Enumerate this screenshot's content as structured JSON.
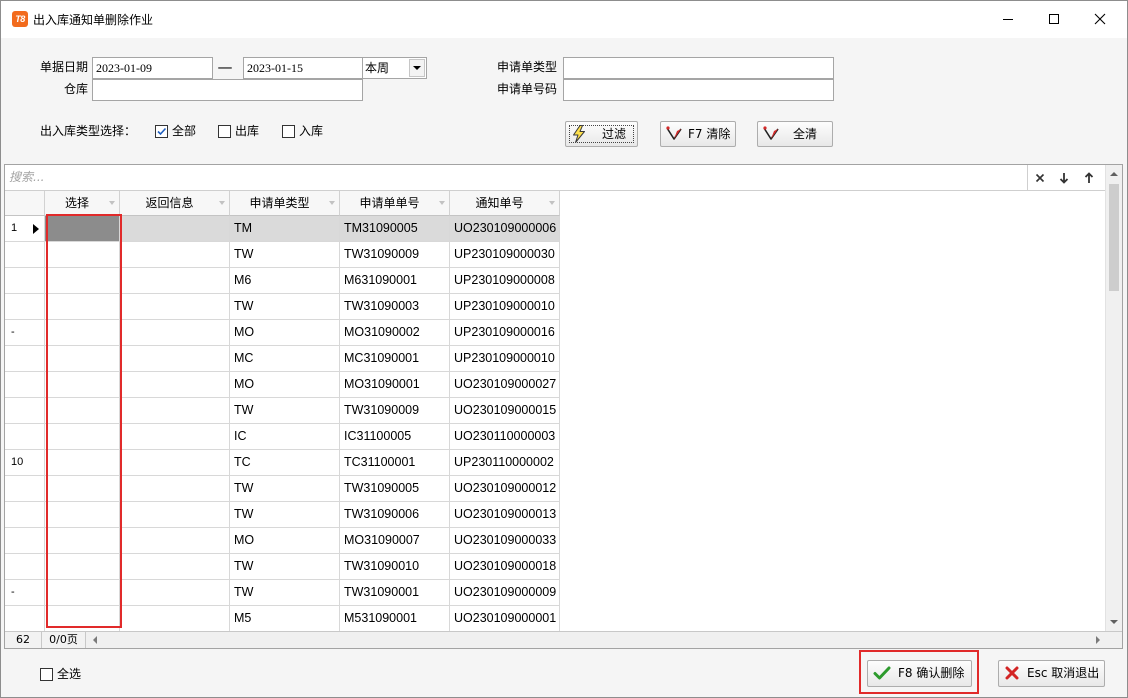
{
  "window": {
    "title": "出入库通知单删除作业",
    "app_icon_text": "T8",
    "controls": {
      "minimize": "minimize-icon",
      "maximize": "maximize-icon",
      "close": "close-icon"
    }
  },
  "colors": {
    "highlight_box": "#e12a2a",
    "app_icon": "#f26b1d",
    "selected_row": "#dadada",
    "selected_cell": "#8c8c8c"
  },
  "filter_form": {
    "date_label": "单据日期",
    "date_from": "2023-01-09",
    "date_separator": "—",
    "date_to": "2023-01-15",
    "period": "本周",
    "warehouse_label": "仓库",
    "warehouse_value": "",
    "request_type_label": "申请单类型",
    "request_type_value": "",
    "request_no_label": "申请单号码",
    "request_no_value": "",
    "io_type_label": "出入库类型选择：",
    "io_types": [
      {
        "label": "全部",
        "checked": true
      },
      {
        "label": "出库",
        "checked": false
      },
      {
        "label": "入库",
        "checked": false
      }
    ]
  },
  "toolbar": {
    "filter": {
      "label": "过滤",
      "icon": "lightning-icon"
    },
    "clear": {
      "label": "F7 清除",
      "icon": "eraser-icon"
    },
    "clear_all": {
      "label": "全清",
      "icon": "eraser-icon"
    }
  },
  "grid": {
    "search_placeholder": "搜索...",
    "search_buttons": [
      "clear-search-icon",
      "find-next-icon",
      "find-prev-icon"
    ],
    "columns": [
      "选择",
      "返回信息",
      "申请单类型",
      "申请单单号",
      "通知单号"
    ],
    "rows": [
      {
        "indicator": "1",
        "current": true,
        "type": "TM",
        "request_no": "TM31090005",
        "notice_no": "UO230109000006"
      },
      {
        "indicator": "",
        "type": "TW",
        "request_no": "TW31090009",
        "notice_no": "UP230109000030"
      },
      {
        "indicator": "",
        "type": "M6",
        "request_no": "M631090001",
        "notice_no": "UP230109000008"
      },
      {
        "indicator": "",
        "type": "TW",
        "request_no": "TW31090003",
        "notice_no": "UP230109000010"
      },
      {
        "indicator": "-",
        "type": "MO",
        "request_no": "MO31090002",
        "notice_no": "UP230109000016"
      },
      {
        "indicator": "",
        "type": "MC",
        "request_no": "MC31090001",
        "notice_no": "UP230109000010"
      },
      {
        "indicator": "",
        "type": "MO",
        "request_no": "MO31090001",
        "notice_no": "UO230109000027"
      },
      {
        "indicator": "",
        "type": "TW",
        "request_no": "TW31090009",
        "notice_no": "UO230109000015"
      },
      {
        "indicator": "",
        "type": "IC",
        "request_no": "IC31100005",
        "notice_no": "UO230110000003"
      },
      {
        "indicator": "10",
        "type": "TC",
        "request_no": "TC31100001",
        "notice_no": "UP230110000002"
      },
      {
        "indicator": "",
        "type": "TW",
        "request_no": "TW31090005",
        "notice_no": "UO230109000012"
      },
      {
        "indicator": "",
        "type": "TW",
        "request_no": "TW31090006",
        "notice_no": "UO230109000013"
      },
      {
        "indicator": "",
        "type": "MO",
        "request_no": "MO31090007",
        "notice_no": "UO230109000033"
      },
      {
        "indicator": "",
        "type": "TW",
        "request_no": "TW31090010",
        "notice_no": "UO230109000018"
      },
      {
        "indicator": "-",
        "type": "TW",
        "request_no": "TW31090001",
        "notice_no": "UO230109000009"
      },
      {
        "indicator": "",
        "type": "M5",
        "request_no": "M531090001",
        "notice_no": "UO230109000001"
      }
    ],
    "record_count": "62",
    "page": "0/0页"
  },
  "footer": {
    "select_all": {
      "label": "全选",
      "checked": false
    },
    "confirm": {
      "label": "F8 确认删除",
      "icon": "check-icon"
    },
    "cancel": {
      "label": "Esc 取消退出",
      "icon": "cancel-x-icon"
    }
  }
}
